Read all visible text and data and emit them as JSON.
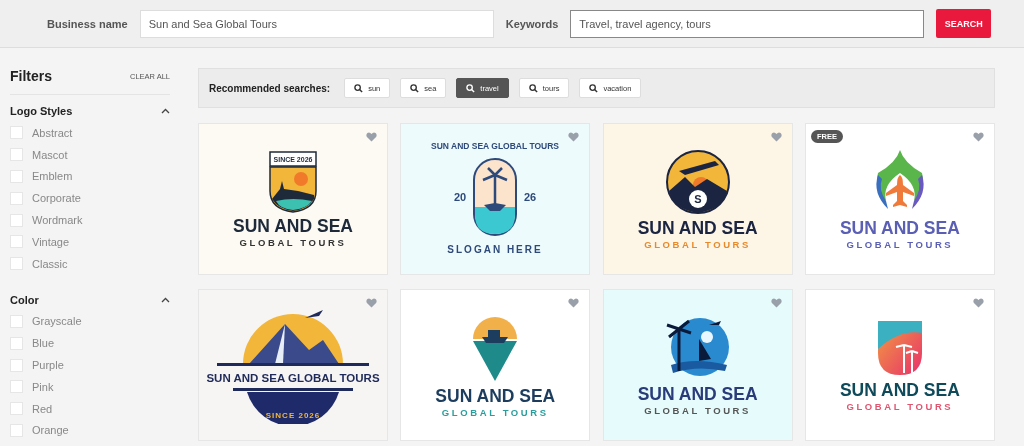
{
  "search_bar": {
    "business_label": "Business name",
    "business_value": "Sun and Sea Global Tours",
    "keywords_label": "Keywords",
    "keywords_value": "Travel, travel agency, tours",
    "button": "SEARCH"
  },
  "filters": {
    "title": "Filters",
    "clear": "CLEAR ALL",
    "sections": [
      {
        "title": "Logo Styles",
        "expanded": true,
        "options": [
          {
            "label": "Abstract",
            "checked": false
          },
          {
            "label": "Mascot",
            "checked": false
          },
          {
            "label": "Emblem",
            "checked": false
          },
          {
            "label": "Corporate",
            "checked": false
          },
          {
            "label": "Wordmark",
            "checked": false
          },
          {
            "label": "Vintage",
            "checked": false
          },
          {
            "label": "Classic",
            "checked": false
          }
        ]
      },
      {
        "title": "Color",
        "expanded": true,
        "options": [
          {
            "label": "Grayscale",
            "checked": false
          },
          {
            "label": "Blue",
            "checked": false
          },
          {
            "label": "Purple",
            "checked": false
          },
          {
            "label": "Pink",
            "checked": false
          },
          {
            "label": "Red",
            "checked": false
          },
          {
            "label": "Orange",
            "checked": false
          }
        ]
      }
    ]
  },
  "recommended": {
    "label": "Recommended searches:",
    "chips": [
      {
        "label": "sun",
        "selected": false
      },
      {
        "label": "sea",
        "selected": false
      },
      {
        "label": "travel",
        "selected": true
      },
      {
        "label": "tours",
        "selected": false
      },
      {
        "label": "vacation",
        "selected": false
      }
    ]
  },
  "logos": [
    {
      "kind": "shield",
      "title": "SUN AND SEA",
      "subtitle": "GLOBAL TOURS",
      "marks": [
        "SINCE 2026"
      ]
    },
    {
      "kind": "arch",
      "marks": [
        "SUN AND SEA GLOBAL TOURS",
        "20",
        "26",
        "SLOGAN HERE"
      ]
    },
    {
      "kind": "circle",
      "title": "SUN AND SEA",
      "subtitle": "GLOBAL TOURS",
      "marks": [
        "S"
      ]
    },
    {
      "kind": "drop",
      "title": "SUN AND SEA",
      "subtitle": "GLOBAL TOURS",
      "badge": "FREE"
    },
    {
      "kind": "banner",
      "marks": [
        "SUN AND SEA GLOBAL TOURS",
        "SINCE 2026"
      ]
    },
    {
      "kind": "pin",
      "title": "SUN AND SEA",
      "subtitle": "GLOBAL TOURS"
    },
    {
      "kind": "round",
      "title": "SUN AND SEA",
      "subtitle": "GLOBAL TOURS"
    },
    {
      "kind": "crest",
      "title": "SUN AND SEA",
      "subtitle": "GLOBAL TOURS"
    }
  ]
}
